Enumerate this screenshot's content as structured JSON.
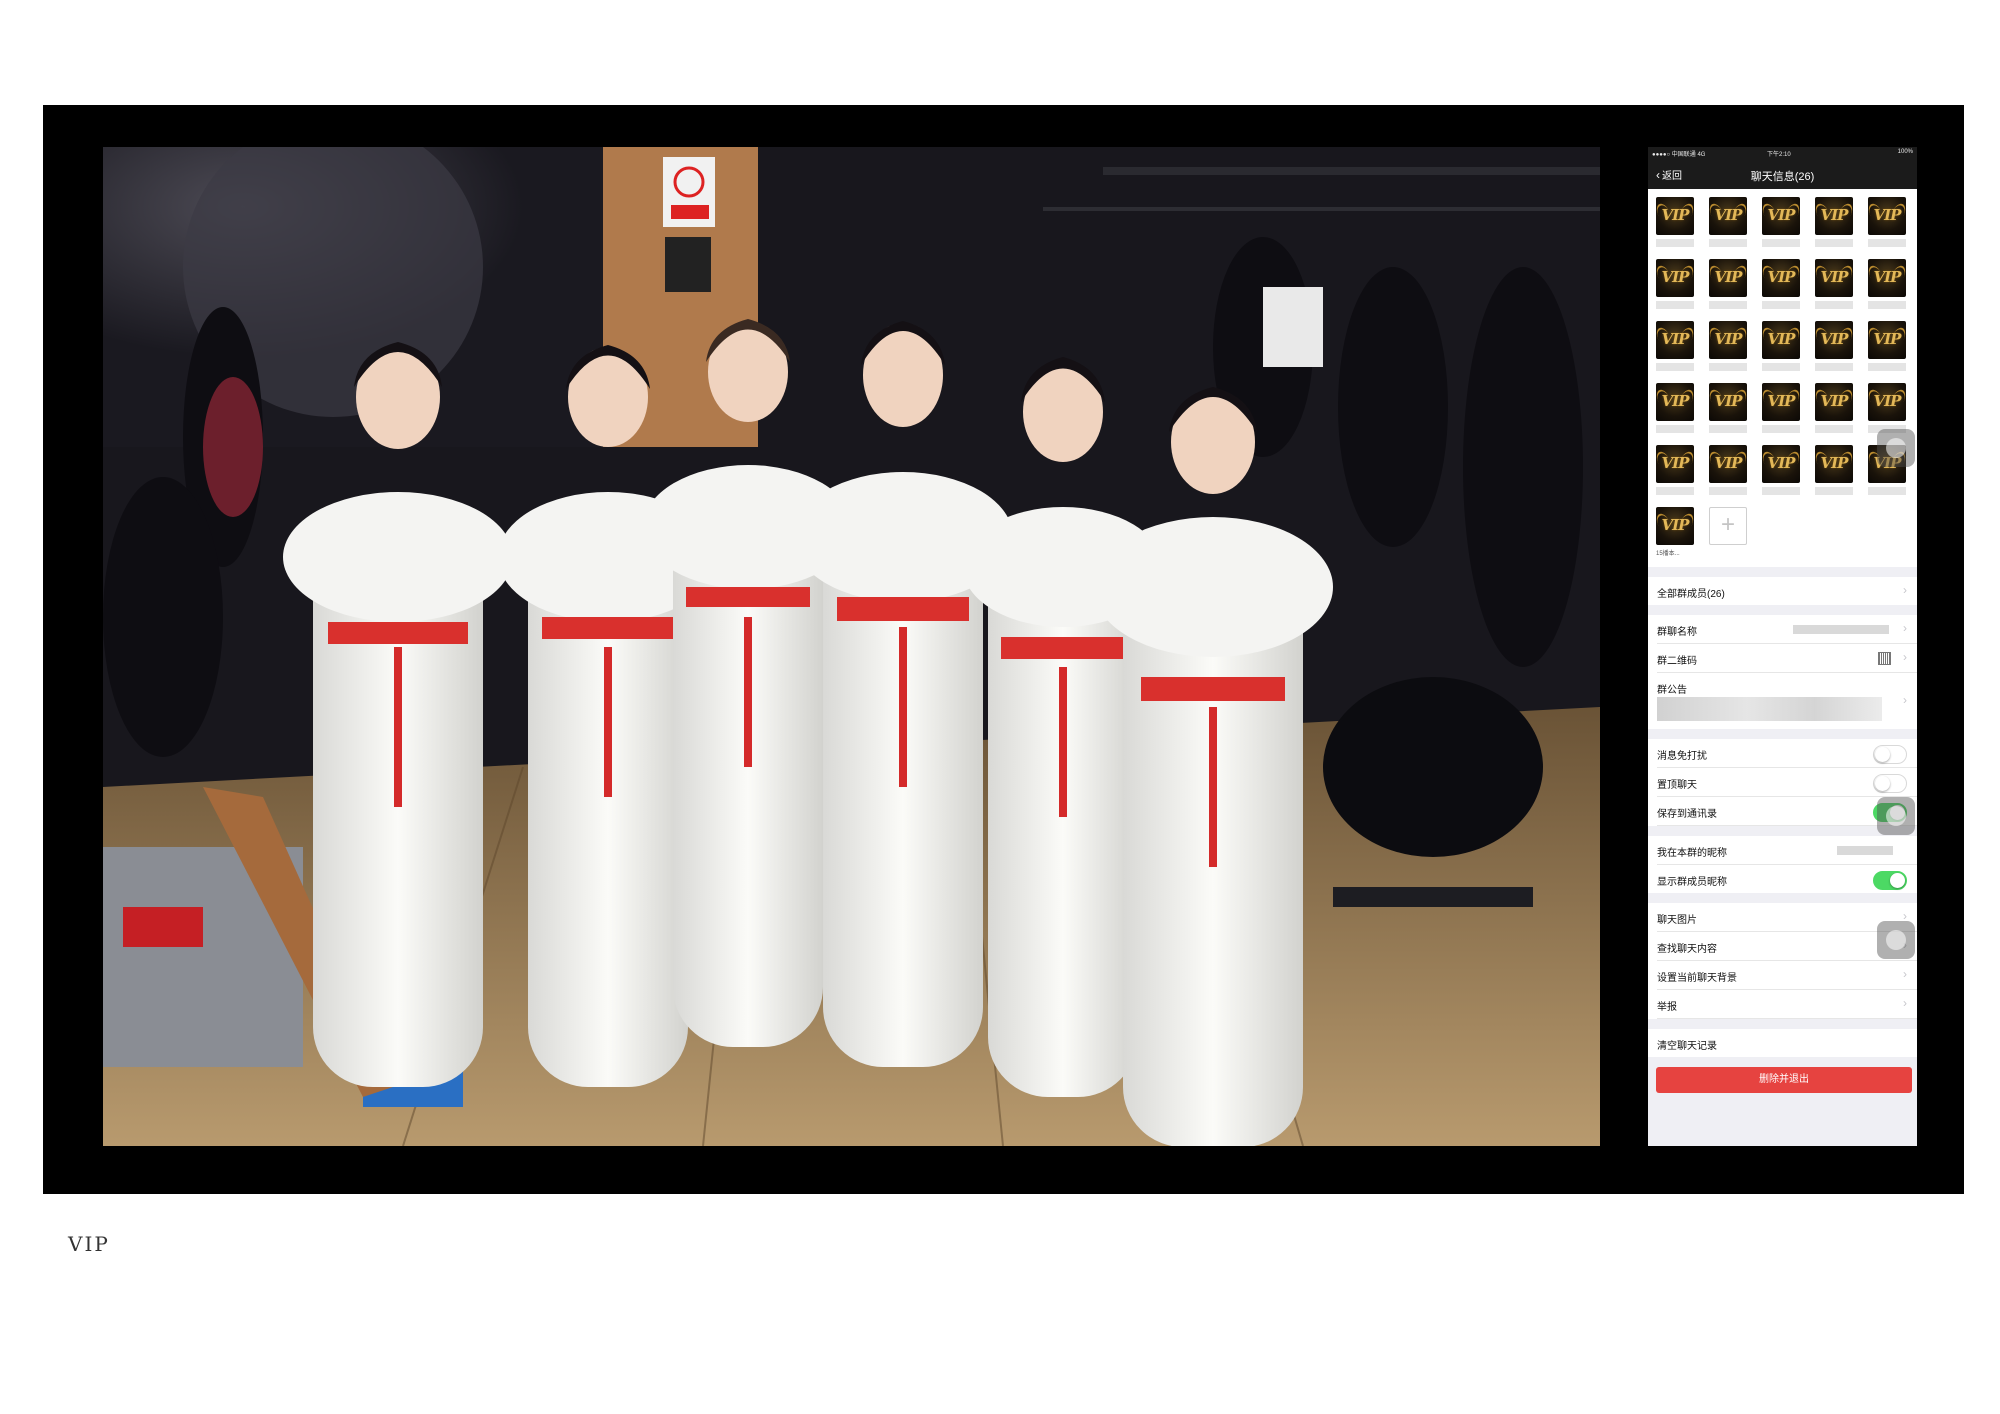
{
  "phone": {
    "status": {
      "carrier": "●●●●○ 中国联通 4G",
      "time": "下午2:10",
      "battery": "100%"
    },
    "nav": {
      "back_label": "返回",
      "title": "聊天信息(26)"
    },
    "members": {
      "vip_text": "VIP",
      "last_member_name": "15播本...",
      "add_symbol": "+"
    },
    "rows": {
      "all_members": "全部群成员(26)",
      "group_name": "群聊名称",
      "group_qr": "群二维码",
      "group_notice": "群公告",
      "mute": "消息免打扰",
      "pin": "置顶聊天",
      "save_contacts": "保存到通讯录",
      "my_nickname": "我在本群的昵称",
      "show_nicknames": "显示群成员昵称",
      "chat_images": "聊天图片",
      "search_chat": "查找聊天内容",
      "set_background": "设置当前聊天背景",
      "report": "举报",
      "clear_history": "清空聊天记录"
    },
    "toggles": {
      "mute": false,
      "pin": false,
      "save_contacts": true,
      "show_nicknames": true
    },
    "chevron": "›",
    "exit_button": "删除并退出",
    "colors": {
      "toggle_on": "#4cd964",
      "exit_button": "#e64340",
      "nav_bar": "#1b1b1b"
    }
  },
  "caption": "VIP"
}
